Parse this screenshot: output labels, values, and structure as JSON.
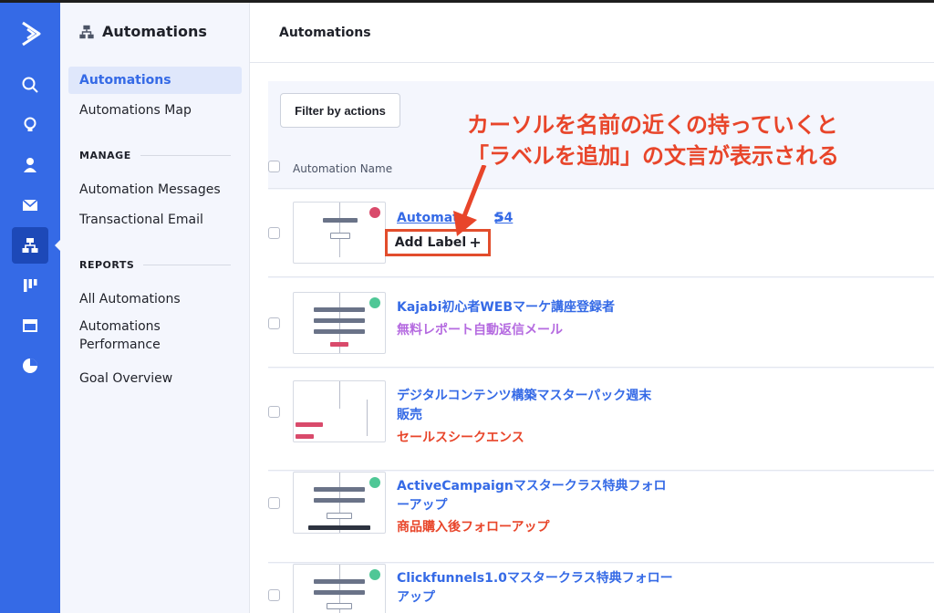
{
  "colors": {
    "accent": "#356ae6",
    "annotation": "#e8452a",
    "status_red": "#d94a6b",
    "status_green": "#4fc796",
    "label_purple": "#b56be0",
    "label_orange": "#e8452a"
  },
  "rail": {
    "logo": "activecampaign-chevron-logo",
    "icons": [
      "search-icon",
      "lightbulb-icon",
      "person-icon",
      "envelope-icon",
      "automation-icon",
      "pipeline-icon",
      "browser-window-icon",
      "pie-chart-icon"
    ],
    "active_icon": "automation-icon"
  },
  "sidebar": {
    "title": "Automations",
    "title_icon": "automation-icon",
    "nav": [
      "Automations",
      "Automations Map"
    ],
    "manage_heading": "MANAGE",
    "manage": [
      "Automation Messages",
      "Transactional Email"
    ],
    "reports_heading": "REPORTS",
    "reports": [
      "All Automations",
      "Automations Performance",
      "Goal Overview"
    ]
  },
  "header": {
    "title": "Automations"
  },
  "toolbar": {
    "filter_label": "Filter by actions"
  },
  "table": {
    "column": "Automation Name",
    "rows": [
      {
        "name": "Automation 54",
        "name_visible": "Automat",
        "name_tail": "54",
        "status": "red",
        "hover_label": "Add Label",
        "hover_icon": "plus-icon"
      },
      {
        "name": "Kajabi初心者WEBマーケ講座登録者",
        "label": "無料レポート自動返信メール",
        "status": "green",
        "label_color": "purple"
      },
      {
        "name_line1": "デジタルコンテンツ構築マスターパック週末",
        "name_line2": "販売",
        "label": "セールスシークエンス",
        "label_color": "orange"
      },
      {
        "name_line1": "ActiveCampaignマスタークラス特典フォロ",
        "name_line2": "ーアップ",
        "label": "商品購入後フォローアップ",
        "status": "green",
        "label_color": "orange"
      },
      {
        "name_line1": "Clickfunnels1.0マスタークラス特典フォロー",
        "name_line2": "アップ",
        "status": "green"
      }
    ]
  },
  "annotation": {
    "line1": "カーソルを名前の近くの持っていくと",
    "line2": "「ラベルを追加」の文言が表示される"
  }
}
